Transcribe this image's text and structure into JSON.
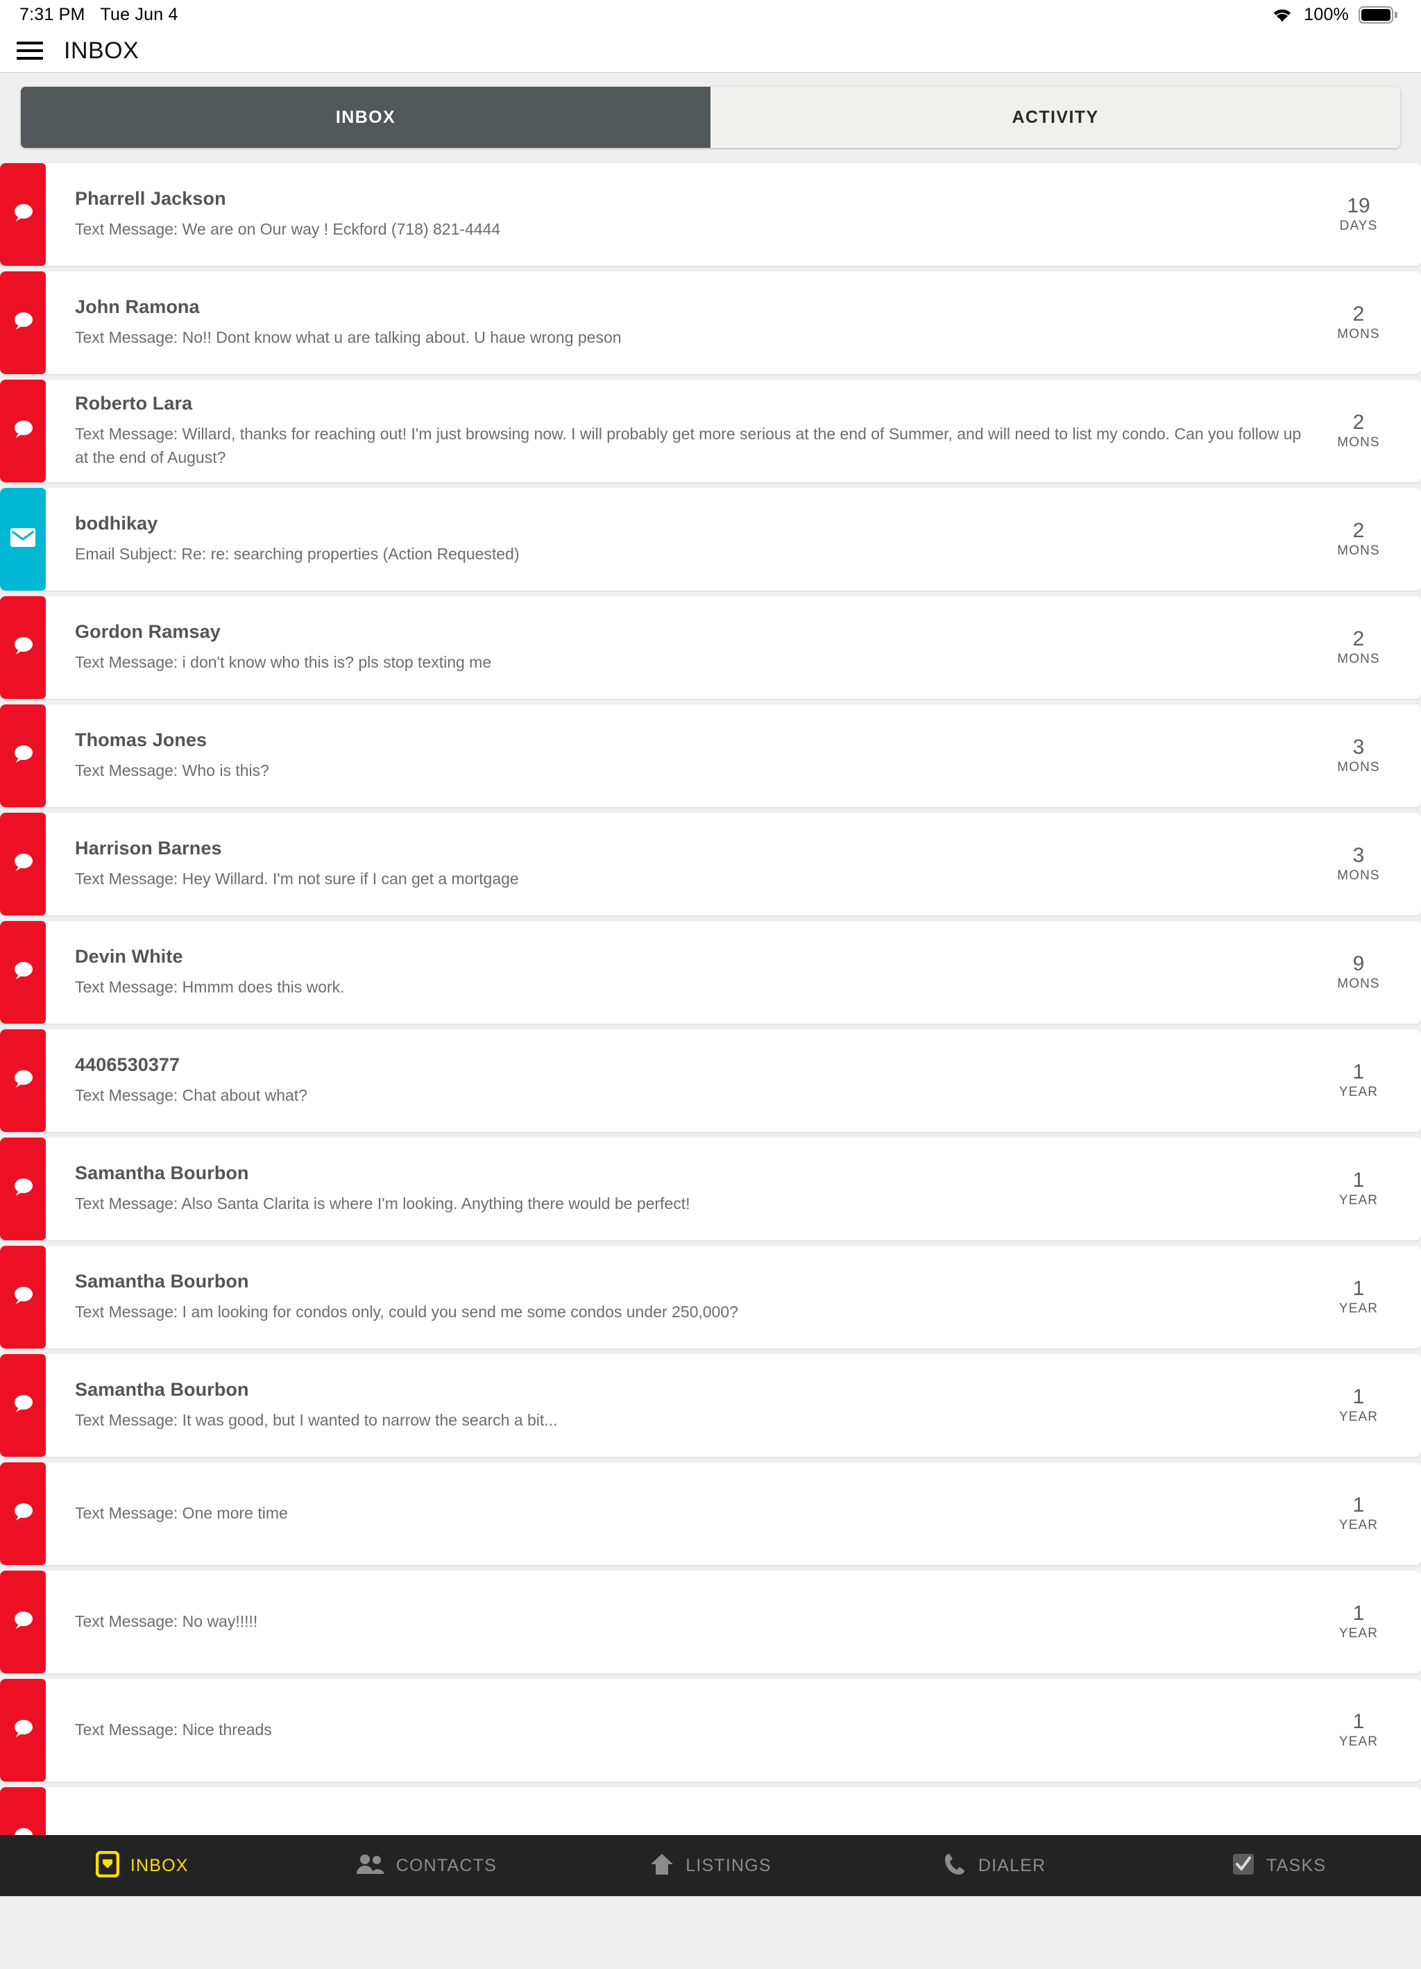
{
  "status_bar": {
    "time": "7:31 PM",
    "date": "Tue Jun 4",
    "battery_percent": "100%",
    "wifi_icon": "wifi-icon",
    "battery_icon": "battery-full-icon"
  },
  "header": {
    "menu_icon": "hamburger-menu-icon",
    "title": "INBOX"
  },
  "tabs": [
    {
      "label": "INBOX",
      "active": true
    },
    {
      "label": "ACTIVITY",
      "active": false
    }
  ],
  "colors": {
    "sms_accent": "#ed1024",
    "email_accent": "#00b8d4",
    "tab_active_bg": "#525759",
    "nav_bg": "#232323",
    "nav_active": "#ffdd00"
  },
  "messages": [
    {
      "name": "Pharrell Jackson",
      "preview": "Text Message: We are on Our way ! Eckford (718) 821-4444",
      "age_value": "19",
      "age_unit": "DAYS",
      "type": "sms",
      "icon": "chat-bubble-icon"
    },
    {
      "name": "John Ramona",
      "preview": "Text Message: No!! Dont know what u are talking about. U haue wrong peson",
      "age_value": "2",
      "age_unit": "MONS",
      "type": "sms",
      "icon": "chat-bubble-icon"
    },
    {
      "name": "Roberto Lara",
      "preview": "Text Message: Willard, thanks for reaching out!  I'm just browsing now.  I will probably get more serious at the end of Summer, and will need to list my condo.  Can you follow up at the end of August?",
      "age_value": "2",
      "age_unit": "MONS",
      "type": "sms",
      "icon": "chat-bubble-icon"
    },
    {
      "name": "bodhikay",
      "preview": "Email Subject: Re: re: searching properties (Action Requested)",
      "age_value": "2",
      "age_unit": "MONS",
      "type": "email",
      "icon": "envelope-icon"
    },
    {
      "name": "Gordon Ramsay",
      "preview": "Text Message: i don't know who this is? pls stop texting me",
      "age_value": "2",
      "age_unit": "MONS",
      "type": "sms",
      "icon": "chat-bubble-icon"
    },
    {
      "name": "Thomas Jones",
      "preview": "Text Message: Who is this?",
      "age_value": "3",
      "age_unit": "MONS",
      "type": "sms",
      "icon": "chat-bubble-icon"
    },
    {
      "name": "Harrison Barnes",
      "preview": "Text Message: Hey Willard. I'm not sure if I can get a mortgage",
      "age_value": "3",
      "age_unit": "MONS",
      "type": "sms",
      "icon": "chat-bubble-icon"
    },
    {
      "name": "Devin White",
      "preview": "Text Message: Hmmm does this work.",
      "age_value": "9",
      "age_unit": "MONS",
      "type": "sms",
      "icon": "chat-bubble-icon"
    },
    {
      "name": "4406530377",
      "preview": "Text Message: Chat about what?",
      "age_value": "1",
      "age_unit": "YEAR",
      "type": "sms",
      "icon": "chat-bubble-icon"
    },
    {
      "name": "Samantha Bourbon",
      "preview": "Text Message: Also Santa Clarita is where I'm looking. Anything there would be perfect!",
      "age_value": "1",
      "age_unit": "YEAR",
      "type": "sms",
      "icon": "chat-bubble-icon"
    },
    {
      "name": "Samantha Bourbon",
      "preview": "Text Message: I am looking for condos only, could you send me some condos under 250,000?",
      "age_value": "1",
      "age_unit": "YEAR",
      "type": "sms",
      "icon": "chat-bubble-icon"
    },
    {
      "name": "Samantha Bourbon",
      "preview": "Text Message: It was good, but I wanted to narrow the search a bit...",
      "age_value": "1",
      "age_unit": "YEAR",
      "type": "sms",
      "icon": "chat-bubble-icon"
    },
    {
      "name": "",
      "preview": "Text Message: One more time",
      "age_value": "1",
      "age_unit": "YEAR",
      "type": "sms",
      "icon": "chat-bubble-icon"
    },
    {
      "name": "",
      "preview": "Text Message: No way!!!!!",
      "age_value": "1",
      "age_unit": "YEAR",
      "type": "sms",
      "icon": "chat-bubble-icon"
    },
    {
      "name": "",
      "preview": "Text Message: Nice threads",
      "age_value": "1",
      "age_unit": "YEAR",
      "type": "sms",
      "icon": "chat-bubble-icon"
    },
    {
      "name": "",
      "preview": "",
      "age_value": "",
      "age_unit": "",
      "type": "sms",
      "icon": "chat-bubble-icon"
    }
  ],
  "bottom_nav": [
    {
      "label": "INBOX",
      "icon": "inbox-icon",
      "active": true
    },
    {
      "label": "CONTACTS",
      "icon": "contacts-icon",
      "active": false
    },
    {
      "label": "LISTINGS",
      "icon": "home-icon",
      "active": false
    },
    {
      "label": "DIALER",
      "icon": "phone-icon",
      "active": false
    },
    {
      "label": "TASKS",
      "icon": "checkbox-icon",
      "active": false
    }
  ]
}
